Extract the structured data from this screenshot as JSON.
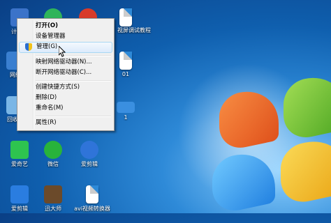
{
  "desktop": {
    "icons": [
      {
        "label": "计算机",
        "icon": "computer-icon",
        "color": "#3b73c9"
      },
      {
        "label": "",
        "icon": "360-icon",
        "color": "#2fb45a"
      },
      {
        "label": "",
        "icon": "bird-game-icon",
        "color": "#d83b2a"
      },
      {
        "label": "",
        "icon": "document-icon",
        "color": "#ffffff"
      },
      {
        "label": "视屏调试教程",
        "icon": "document-icon",
        "color": "#ffffff"
      },
      {
        "label": "网络",
        "icon": "network-icon",
        "color": "#3a7fd0"
      },
      {
        "label": "01",
        "icon": "document-icon",
        "color": "#ffffff"
      },
      {
        "label": "回收站",
        "icon": "recycle-bin-icon",
        "color": "#7ab6e6"
      },
      {
        "label": "1",
        "icon": "monitor-icon",
        "color": "#3a8fe0"
      },
      {
        "label": "爱奇艺",
        "icon": "iqiyi-icon",
        "color": "#2ec44f"
      },
      {
        "label": "微信",
        "icon": "wechat-icon",
        "color": "#28b33b"
      },
      {
        "label": "爱剪辑",
        "icon": "aijianji-icon",
        "color": "#2f74d9"
      },
      {
        "label": "爱剪辑",
        "icon": "video-player-icon",
        "color": "#2a7de0"
      },
      {
        "label": "迅大师",
        "icon": "game-icon",
        "color": "#6b4a2a"
      },
      {
        "label": "avi视频转换器",
        "icon": "avi-doc-icon",
        "color": "#ffffff"
      }
    ]
  },
  "context_menu": {
    "items": [
      {
        "label": "打开(O)",
        "bold": true
      },
      {
        "label": "设备管理器"
      },
      {
        "label": "管理(G)",
        "highlighted": true
      },
      {
        "label": "映射网络驱动器(N)..."
      },
      {
        "label": "断开网络驱动器(C)..."
      },
      {
        "label": "创建快捷方式(S)"
      },
      {
        "label": "删除(D)"
      },
      {
        "label": "重命名(M)"
      },
      {
        "label": "属性(R)"
      }
    ]
  }
}
